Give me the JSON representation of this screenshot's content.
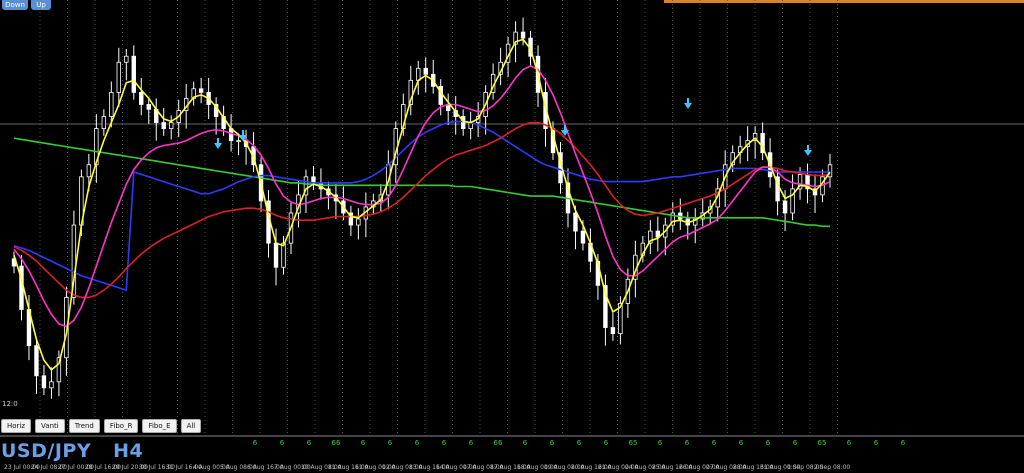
{
  "window": {
    "symbol": "USD/JPY",
    "timeframe": "H4",
    "scale_label": "12:0"
  },
  "top_buttons": [
    "Down",
    "Up"
  ],
  "toolbar": [
    "Horiz",
    "Vanti",
    "Trend",
    "Fibo_R",
    "Fibo_E",
    "All"
  ],
  "colors": {
    "background": "#000000",
    "candle": "#ffffff",
    "ma_fast": "#ffff33",
    "ma_mid": "#ff33cc",
    "ma_red": "#e02020",
    "ma_blue": "#2a3cff",
    "ma_long": "#33cc33",
    "signal_arrow": "#33ccff",
    "period_sep": "#555555",
    "accent": "#d9822b",
    "symbol_text": "#6aa0e6"
  },
  "chart_data": {
    "type": "candlestick",
    "x_labels": [
      "23 Jul 00:00",
      "24 Jul 08:00",
      "27 Jul 00:00",
      "28 Jul 16:00",
      "29 Jul 20:00",
      "30 Jul 16:00",
      "31 Jul 16:00",
      "4 Aug 00:00",
      "5 Aug 08:00",
      "6 Aug 16:00",
      "7 Aug 00:00",
      "10 Aug 08:00",
      "11 Aug 16:00",
      "11 Aug 00:00",
      "12 Aug 08:00",
      "13 Aug 16:00",
      "14 Aug 00:00",
      "17 Aug 08:00",
      "17 Aug 16:00",
      "18 Aug 00:00",
      "19 Aug 08:00",
      "20 Aug 16:00",
      "21 Aug 00:00",
      "24 Aug 08:00",
      "25 Aug 16:00",
      "26 Aug 00:00",
      "27 Aug 08:00",
      "28 Aug 16:00",
      "31 Aug 00:00",
      "1 Sep 08:00",
      "2 Sep 08:00"
    ],
    "sep_labels": [
      "6",
      "6",
      "6",
      "66",
      "6",
      "6",
      "6",
      "6",
      "6",
      "66",
      "6",
      "6",
      "6",
      "6",
      "65",
      "6",
      "6",
      "6",
      "6",
      "6",
      "6",
      "65",
      "6",
      "6",
      "6"
    ],
    "close": [
      186,
      150,
      120,
      95,
      85,
      90,
      110,
      160,
      220,
      260,
      270,
      300,
      310,
      330,
      355,
      360,
      330,
      320,
      316,
      305,
      300,
      305,
      315,
      325,
      333,
      330,
      320,
      310,
      300,
      290,
      290,
      285,
      270,
      240,
      205,
      185,
      205,
      230,
      245,
      260,
      255,
      250,
      245,
      240,
      230,
      220,
      225,
      235,
      240,
      245,
      270,
      300,
      320,
      340,
      350,
      345,
      335,
      320,
      315,
      310,
      300,
      305,
      310,
      330,
      345,
      355,
      370,
      380,
      375,
      360,
      330,
      300,
      280,
      255,
      230,
      215,
      205,
      190,
      170,
      135,
      130,
      155,
      175,
      195,
      205,
      215,
      210,
      220,
      230,
      225,
      220,
      225,
      230,
      235,
      250,
      270,
      280,
      285,
      290,
      296,
      280,
      260,
      240,
      230,
      250,
      262,
      250,
      245,
      260,
      270
    ],
    "ma_fast": [
      195,
      175,
      150,
      125,
      108,
      100,
      105,
      130,
      175,
      220,
      252,
      272,
      290,
      305,
      320,
      338,
      340,
      332,
      325,
      316,
      308,
      306,
      310,
      318,
      326,
      328,
      325,
      318,
      309,
      300,
      295,
      288,
      276,
      255,
      228,
      205,
      203,
      218,
      235,
      250,
      254,
      252,
      248,
      243,
      235,
      227,
      226,
      231,
      236,
      241,
      256,
      280,
      302,
      324,
      340,
      344,
      340,
      330,
      322,
      314,
      306,
      305,
      308,
      320,
      335,
      347,
      360,
      372,
      374,
      366,
      345,
      318,
      295,
      272,
      250,
      232,
      220,
      205,
      188,
      163,
      148,
      152,
      165,
      182,
      196,
      207,
      209,
      215,
      223,
      224,
      222,
      224,
      228,
      233,
      244,
      260,
      272,
      280,
      287,
      292,
      285,
      270,
      254,
      242,
      245,
      253,
      252,
      248,
      255,
      264
    ],
    "ma_mid": [
      200,
      192,
      182,
      170,
      157,
      146,
      138,
      136,
      141,
      152,
      168,
      186,
      204,
      222,
      238,
      254,
      266,
      274,
      280,
      284,
      286,
      287,
      288,
      290,
      293,
      296,
      298,
      299,
      298,
      296,
      294,
      291,
      286,
      278,
      267,
      254,
      244,
      239,
      237,
      238,
      240,
      242,
      243,
      243,
      242,
      240,
      238,
      237,
      237,
      238,
      243,
      253,
      266,
      280,
      294,
      305,
      313,
      318,
      320,
      320,
      318,
      316,
      314,
      315,
      319,
      325,
      333,
      342,
      349,
      352,
      349,
      340,
      328,
      313,
      296,
      279,
      263,
      247,
      230,
      211,
      194,
      183,
      178,
      178,
      182,
      188,
      194,
      200,
      206,
      210,
      212,
      215,
      218,
      221,
      225,
      232,
      240,
      248,
      256,
      264,
      268,
      268,
      264,
      258,
      255,
      254,
      253,
      252,
      253,
      256
    ],
    "ma_red": [
      202,
      199,
      195,
      190,
      184,
      178,
      172,
      166,
      162,
      160,
      160,
      162,
      166,
      171,
      177,
      184,
      190,
      196,
      201,
      205,
      209,
      212,
      215,
      218,
      221,
      224,
      227,
      229,
      231,
      232,
      233,
      234,
      234,
      233,
      231,
      228,
      226,
      225,
      224,
      224,
      224,
      225,
      226,
      227,
      227,
      227,
      227,
      228,
      229,
      231,
      234,
      238,
      243,
      249,
      255,
      261,
      266,
      271,
      275,
      278,
      280,
      282,
      284,
      286,
      289,
      292,
      296,
      300,
      303,
      305,
      305,
      303,
      300,
      296,
      290,
      284,
      277,
      270,
      262,
      253,
      244,
      237,
      232,
      229,
      228,
      229,
      230,
      232,
      234,
      236,
      238,
      240,
      242,
      244,
      247,
      250,
      254,
      258,
      262,
      266,
      268,
      268,
      267,
      265,
      264,
      263,
      262,
      261,
      261,
      262
    ],
    "ma_blue": [
      203,
      201,
      199,
      196,
      193,
      190,
      187,
      184,
      181,
      178,
      176,
      174,
      172,
      170,
      168,
      166,
      264,
      262,
      260,
      258,
      256,
      254,
      252,
      250,
      248,
      246,
      246,
      248,
      250,
      253,
      256,
      258,
      260,
      261,
      261,
      260,
      259,
      258,
      257,
      256,
      255,
      255,
      255,
      255,
      255,
      255,
      256,
      258,
      261,
      265,
      270,
      276,
      282,
      288,
      293,
      297,
      300,
      303,
      305,
      306,
      306,
      305,
      303,
      300,
      297,
      293,
      289,
      285,
      281,
      277,
      273,
      270,
      268,
      266,
      264,
      262,
      260,
      258,
      257,
      256,
      256,
      256,
      256,
      256,
      256,
      257,
      258,
      259,
      260,
      260,
      261,
      262,
      263,
      264,
      265,
      266,
      267,
      267,
      267,
      267,
      266,
      265,
      264,
      264,
      264,
      264,
      264,
      264,
      264,
      264
    ],
    "ma_long": [
      292,
      291,
      290,
      289,
      288,
      287,
      286,
      285,
      284,
      283,
      282,
      281,
      280,
      279,
      278,
      277,
      276,
      275,
      274,
      273,
      272,
      271,
      270,
      269,
      268,
      267,
      266,
      265,
      264,
      263,
      262,
      261,
      260,
      259,
      258,
      257,
      256,
      255,
      255,
      254,
      254,
      253,
      253,
      253,
      253,
      253,
      253,
      253,
      253,
      253,
      253,
      253,
      253,
      253,
      253,
      253,
      253,
      253,
      253,
      252,
      252,
      252,
      251,
      250,
      249,
      248,
      247,
      246,
      245,
      244,
      244,
      244,
      244,
      243,
      242,
      241,
      240,
      239,
      238,
      237,
      236,
      235,
      234,
      233,
      232,
      231,
      230,
      229,
      228,
      227,
      226,
      226,
      226,
      226,
      226,
      226,
      226,
      226,
      226,
      226,
      226,
      225,
      224,
      223,
      222,
      221,
      220,
      220,
      219,
      219
    ]
  }
}
